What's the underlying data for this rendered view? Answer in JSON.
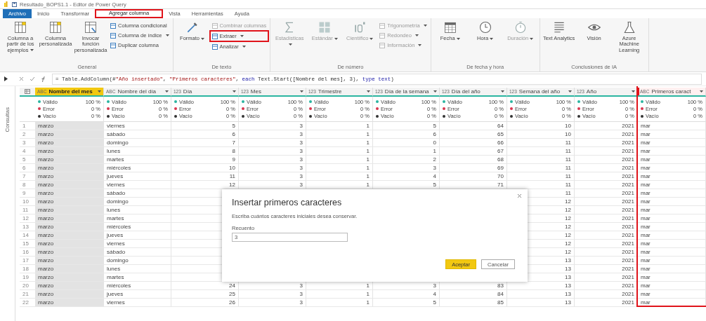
{
  "window": {
    "title": "Resultado_BOPS1.1 - Editor de Power Query"
  },
  "tabs": [
    {
      "label": "Archivo",
      "kind": "file",
      "selected": false,
      "highlighted": false
    },
    {
      "label": "Inicio",
      "kind": "tab",
      "selected": false,
      "highlighted": false
    },
    {
      "label": "Transformar",
      "kind": "tab",
      "selected": false,
      "highlighted": false
    },
    {
      "label": "Agregar columna",
      "kind": "tab",
      "selected": true,
      "highlighted": true
    },
    {
      "label": "Vista",
      "kind": "tab",
      "selected": false,
      "highlighted": false
    },
    {
      "label": "Herramientas",
      "kind": "tab",
      "selected": false,
      "highlighted": false
    },
    {
      "label": "Ayuda",
      "kind": "tab",
      "selected": false,
      "highlighted": false
    }
  ],
  "ribbon": {
    "groups": [
      {
        "label": "General",
        "items": [
          {
            "kind": "large",
            "label": "Columna a partir de los ejemplos",
            "dropdown": true,
            "disabled": false,
            "highlighted": false
          },
          {
            "kind": "large",
            "label": "Columna personalizada",
            "dropdown": false,
            "disabled": false,
            "highlighted": false
          },
          {
            "kind": "large",
            "label": "Invocar función personalizada",
            "dropdown": false,
            "disabled": false,
            "highlighted": false
          },
          {
            "kind": "small",
            "label": "Columna condicional",
            "dropdown": false,
            "disabled": false,
            "highlighted": false
          },
          {
            "kind": "small",
            "label": "Columna de índice",
            "dropdown": true,
            "disabled": false,
            "highlighted": false
          },
          {
            "kind": "small",
            "label": "Duplicar columna",
            "dropdown": false,
            "disabled": false,
            "highlighted": false
          }
        ]
      },
      {
        "label": "De texto",
        "items": [
          {
            "kind": "large",
            "label": "Formato",
            "dropdown": true,
            "disabled": false,
            "highlighted": false
          },
          {
            "kind": "small",
            "label": "Combinar columnas",
            "dropdown": false,
            "disabled": true,
            "highlighted": false
          },
          {
            "kind": "small",
            "label": "Extraer",
            "dropdown": true,
            "disabled": false,
            "highlighted": true
          },
          {
            "kind": "small",
            "label": "Analizar",
            "dropdown": true,
            "disabled": false,
            "highlighted": false
          }
        ]
      },
      {
        "label": "De número",
        "items": [
          {
            "kind": "large",
            "label": "Estadísticas",
            "dropdown": true,
            "disabled": true,
            "highlighted": false
          },
          {
            "kind": "large",
            "label": "Estándar",
            "dropdown": true,
            "disabled": true,
            "highlighted": false
          },
          {
            "kind": "large",
            "label": "Científico",
            "dropdown": true,
            "disabled": true,
            "highlighted": false
          },
          {
            "kind": "small",
            "label": "Trigonometría",
            "dropdown": true,
            "disabled": true,
            "highlighted": false
          },
          {
            "kind": "small",
            "label": "Redondeo",
            "dropdown": true,
            "disabled": true,
            "highlighted": false
          },
          {
            "kind": "small",
            "label": "Información",
            "dropdown": true,
            "disabled": true,
            "highlighted": false
          }
        ]
      },
      {
        "label": "De fecha y hora",
        "items": [
          {
            "kind": "large",
            "label": "Fecha",
            "dropdown": true,
            "disabled": false,
            "highlighted": false
          },
          {
            "kind": "large",
            "label": "Hora",
            "dropdown": true,
            "disabled": false,
            "highlighted": false
          },
          {
            "kind": "large",
            "label": "Duración",
            "dropdown": true,
            "disabled": true,
            "highlighted": false
          }
        ]
      },
      {
        "label": "Conclusiones de IA",
        "items": [
          {
            "kind": "large",
            "label": "Text Analytics",
            "dropdown": false,
            "disabled": false,
            "highlighted": false
          },
          {
            "kind": "large",
            "label": "Visión",
            "dropdown": false,
            "disabled": false,
            "highlighted": false
          },
          {
            "kind": "large",
            "label": "Azure Machine Learning",
            "dropdown": false,
            "disabled": false,
            "highlighted": false
          }
        ]
      }
    ]
  },
  "formula": {
    "tokens": [
      {
        "kind": "plain",
        "text": "= Table.AddColumn(#"
      },
      {
        "kind": "string",
        "text": "\"Año insertado\""
      },
      {
        "kind": "plain",
        "text": ", "
      },
      {
        "kind": "string",
        "text": "\"Primeros caracteres\""
      },
      {
        "kind": "plain",
        "text": ", "
      },
      {
        "kind": "keyword",
        "text": "each"
      },
      {
        "kind": "plain",
        "text": " Text.Start([Nombre del mes], 3), "
      },
      {
        "kind": "keyword",
        "text": "type text"
      },
      {
        "kind": "plain",
        "text": ")"
      }
    ]
  },
  "side_pane": {
    "label": "Consultas"
  },
  "table": {
    "columns": [
      {
        "name": "Nombre del mes",
        "type_label": "ABC",
        "kind": "text",
        "selected": true,
        "highlighted": false,
        "quality": [
          {
            "label": "Válido",
            "percent": "100 %",
            "color": "#2bb5a0"
          },
          {
            "label": "Error",
            "percent": "0 %",
            "color": "#d9364e"
          },
          {
            "label": "Vacío",
            "percent": "0 %",
            "color": "#333333"
          }
        ]
      },
      {
        "name": "Nombre del día",
        "type_label": "ABC",
        "kind": "text",
        "selected": false,
        "highlighted": false,
        "quality": [
          {
            "label": "Válido",
            "percent": "100 %",
            "color": "#2bb5a0"
          },
          {
            "label": "Error",
            "percent": "0 %",
            "color": "#d9364e"
          },
          {
            "label": "Vacío",
            "percent": "0 %",
            "color": "#333333"
          }
        ]
      },
      {
        "name": "Día",
        "type_label": "123",
        "kind": "number",
        "selected": false,
        "highlighted": false,
        "quality": [
          {
            "label": "Válido",
            "percent": "100 %",
            "color": "#2bb5a0"
          },
          {
            "label": "Error",
            "percent": "0 %",
            "color": "#d9364e"
          },
          {
            "label": "Vacío",
            "percent": "0 %",
            "color": "#333333"
          }
        ]
      },
      {
        "name": "Mes",
        "type_label": "123",
        "kind": "number",
        "selected": false,
        "highlighted": false,
        "quality": [
          {
            "label": "Válido",
            "percent": "100 %",
            "color": "#2bb5a0"
          },
          {
            "label": "Error",
            "percent": "0 %",
            "color": "#d9364e"
          },
          {
            "label": "Vacío",
            "percent": "0 %",
            "color": "#333333"
          }
        ]
      },
      {
        "name": "Trimestre",
        "type_label": "123",
        "kind": "number",
        "selected": false,
        "highlighted": false,
        "quality": [
          {
            "label": "Válido",
            "percent": "100 %",
            "color": "#2bb5a0"
          },
          {
            "label": "Error",
            "percent": "0 %",
            "color": "#d9364e"
          },
          {
            "label": "Vacío",
            "percent": "0 %",
            "color": "#333333"
          }
        ]
      },
      {
        "name": "Día de la semana",
        "type_label": "123",
        "kind": "number",
        "selected": false,
        "highlighted": false,
        "quality": [
          {
            "label": "Válido",
            "percent": "100 %",
            "color": "#2bb5a0"
          },
          {
            "label": "Error",
            "percent": "0 %",
            "color": "#d9364e"
          },
          {
            "label": "Vacío",
            "percent": "0 %",
            "color": "#333333"
          }
        ]
      },
      {
        "name": "Día del año",
        "type_label": "123",
        "kind": "number",
        "selected": false,
        "highlighted": false,
        "quality": [
          {
            "label": "Válido",
            "percent": "100 %",
            "color": "#2bb5a0"
          },
          {
            "label": "Error",
            "percent": "0 %",
            "color": "#d9364e"
          },
          {
            "label": "Vacío",
            "percent": "0 %",
            "color": "#333333"
          }
        ]
      },
      {
        "name": "Semana del año",
        "type_label": "123",
        "kind": "number",
        "selected": false,
        "highlighted": false,
        "quality": [
          {
            "label": "Válido",
            "percent": "100 %",
            "color": "#2bb5a0"
          },
          {
            "label": "Error",
            "percent": "0 %",
            "color": "#d9364e"
          },
          {
            "label": "Vacío",
            "percent": "0 %",
            "color": "#333333"
          }
        ]
      },
      {
        "name": "Año",
        "type_label": "123",
        "kind": "number",
        "selected": false,
        "highlighted": false,
        "quality": [
          {
            "label": "Válido",
            "percent": "100 %",
            "color": "#2bb5a0"
          },
          {
            "label": "Error",
            "percent": "0 %",
            "color": "#d9364e"
          },
          {
            "label": "Vacío",
            "percent": "0 %",
            "color": "#333333"
          }
        ]
      },
      {
        "name": "Primeros caract",
        "type_label": "ABC",
        "kind": "text",
        "selected": false,
        "highlighted": true,
        "quality": [
          {
            "label": "Válido",
            "percent": "100 %",
            "color": "#2bb5a0"
          },
          {
            "label": "Error",
            "percent": "0 %",
            "color": "#d9364e"
          },
          {
            "label": "Vacío",
            "percent": "0 %",
            "color": "#333333"
          }
        ]
      }
    ],
    "rows": [
      {
        "number": "1",
        "kind": "full",
        "cells": [
          "marzo",
          "viernes",
          "5",
          "3",
          "1",
          "5",
          "64",
          "10",
          "2021",
          "mar"
        ]
      },
      {
        "number": "2",
        "kind": "full",
        "cells": [
          "marzo",
          "sábado",
          "6",
          "3",
          "1",
          "6",
          "65",
          "10",
          "2021",
          "mar"
        ]
      },
      {
        "number": "3",
        "kind": "full",
        "cells": [
          "marzo",
          "domingo",
          "7",
          "3",
          "1",
          "0",
          "66",
          "11",
          "2021",
          "mar"
        ]
      },
      {
        "number": "4",
        "kind": "full",
        "cells": [
          "marzo",
          "lunes",
          "8",
          "3",
          "1",
          "1",
          "67",
          "11",
          "2021",
          "mar"
        ]
      },
      {
        "number": "5",
        "kind": "full",
        "cells": [
          "marzo",
          "martes",
          "9",
          "3",
          "1",
          "2",
          "68",
          "11",
          "2021",
          "mar"
        ]
      },
      {
        "number": "6",
        "kind": "full",
        "cells": [
          "marzo",
          "miércoles",
          "10",
          "3",
          "1",
          "3",
          "69",
          "11",
          "2021",
          "mar"
        ]
      },
      {
        "number": "7",
        "kind": "full",
        "cells": [
          "marzo",
          "jueves",
          "11",
          "3",
          "1",
          "4",
          "70",
          "11",
          "2021",
          "mar"
        ]
      },
      {
        "number": "8",
        "kind": "full",
        "cells": [
          "marzo",
          "viernes",
          "12",
          "3",
          "1",
          "5",
          "71",
          "11",
          "2021",
          "mar"
        ]
      },
      {
        "number": "9",
        "kind": "covered",
        "cells": [
          "marzo",
          "sábado",
          "11",
          "2021",
          "mar"
        ]
      },
      {
        "number": "10",
        "kind": "covered",
        "cells": [
          "marzo",
          "domingo",
          "12",
          "2021",
          "mar"
        ]
      },
      {
        "number": "11",
        "kind": "covered",
        "cells": [
          "marzo",
          "lunes",
          "12",
          "2021",
          "mar"
        ]
      },
      {
        "number": "12",
        "kind": "covered",
        "cells": [
          "marzo",
          "martes",
          "12",
          "2021",
          "mar"
        ]
      },
      {
        "number": "13",
        "kind": "covered",
        "cells": [
          "marzo",
          "miércoles",
          "12",
          "2021",
          "mar"
        ]
      },
      {
        "number": "14",
        "kind": "covered",
        "cells": [
          "marzo",
          "jueves",
          "12",
          "2021",
          "mar"
        ]
      },
      {
        "number": "15",
        "kind": "covered",
        "cells": [
          "marzo",
          "viernes",
          "12",
          "2021",
          "mar"
        ]
      },
      {
        "number": "16",
        "kind": "covered",
        "cells": [
          "marzo",
          "sábado",
          "12",
          "2021",
          "mar"
        ]
      },
      {
        "number": "17",
        "kind": "covered",
        "cells": [
          "marzo",
          "domingo",
          "13",
          "2021",
          "mar"
        ]
      },
      {
        "number": "18",
        "kind": "covered",
        "cells": [
          "marzo",
          "lunes",
          "13",
          "2021",
          "mar"
        ]
      },
      {
        "number": "19",
        "kind": "covered",
        "cells": [
          "marzo",
          "martes",
          "13",
          "2021",
          "mar"
        ]
      },
      {
        "number": "20",
        "kind": "full",
        "cells": [
          "marzo",
          "miércoles",
          "24",
          "3",
          "1",
          "3",
          "83",
          "13",
          "2021",
          "mar"
        ]
      },
      {
        "number": "21",
        "kind": "full",
        "cells": [
          "marzo",
          "jueves",
          "25",
          "3",
          "1",
          "4",
          "84",
          "13",
          "2021",
          "mar"
        ]
      },
      {
        "number": "22",
        "kind": "full",
        "cells": [
          "marzo",
          "viernes",
          "26",
          "3",
          "1",
          "5",
          "85",
          "13",
          "2021",
          "mar"
        ]
      }
    ]
  },
  "dialog": {
    "title": "Insertar primeros caracteres",
    "prompt": "Escriba cuántos caracteres iniciales desea conservar.",
    "field": {
      "label": "Recuento",
      "value": "3"
    },
    "buttons": [
      {
        "label": "Aceptar",
        "kind": "primary"
      },
      {
        "label": "Cancelar",
        "kind": "secondary"
      }
    ]
  }
}
